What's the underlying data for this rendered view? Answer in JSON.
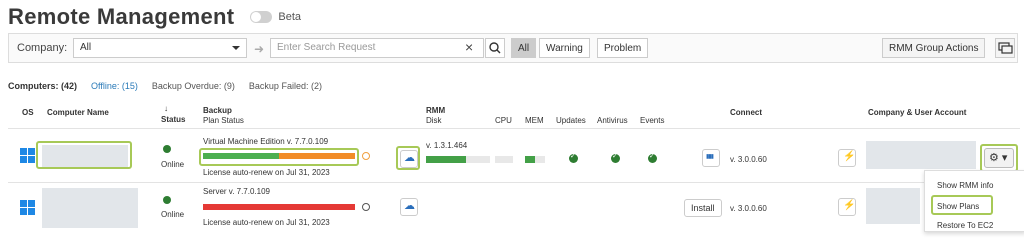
{
  "header": {
    "title": "Remote Management",
    "beta_label": "Beta"
  },
  "filter": {
    "company_label": "Company:",
    "company_value": "All",
    "search_placeholder": "Enter Search Request",
    "segments": [
      "All",
      "Warning",
      "Problem"
    ],
    "rmm_group_actions": "RMM Group Actions"
  },
  "counters": {
    "computers": "Computers: (42)",
    "offline": "Offline: (15)",
    "backup_overdue": "Backup Overdue: (9)",
    "backup_failed": "Backup Failed: (2)"
  },
  "columns": {
    "os": "OS",
    "computer_name": "Computer Name",
    "status_arrow": "↓",
    "status": "Status",
    "backup": "Backup",
    "plan_status": "Plan Status",
    "rmm": "RMM",
    "disk": "Disk",
    "cpu": "CPU",
    "mem": "MEM",
    "updates": "Updates",
    "antivirus": "Antivirus",
    "events": "Events",
    "connect": "Connect",
    "company_user": "Company & User Account"
  },
  "rows": [
    {
      "status": "Online",
      "edition": "Virtual Machine Edition v. 7.7.0.109",
      "license": "License auto-renew on Jul 31, 2023",
      "backup_progress": {
        "green_fraction": 0.5,
        "orange_fraction": 0.5
      },
      "rmm_version": "v. 1.3.1.464",
      "disk_fraction": 0.62,
      "connect_version": "v. 3.0.0.60"
    },
    {
      "status": "Online",
      "edition": "Server v. 7.7.0.109",
      "license": "License auto-renew on Jul 31, 2023",
      "backup_progress": {
        "red_fraction": 1.0
      },
      "install_label": "Install",
      "connect_version": "v. 3.0.0.60"
    }
  ],
  "menu": {
    "items": [
      "Show RMM info",
      "Show Plans",
      "Restore To EC2"
    ]
  },
  "colors": {
    "accent_green": "#a7c957",
    "ok_green": "#2e7d32",
    "link_blue": "#2a7ab8",
    "bar_orange": "#f28c28",
    "bar_red": "#e53935",
    "bar_green": "#4caf50"
  }
}
